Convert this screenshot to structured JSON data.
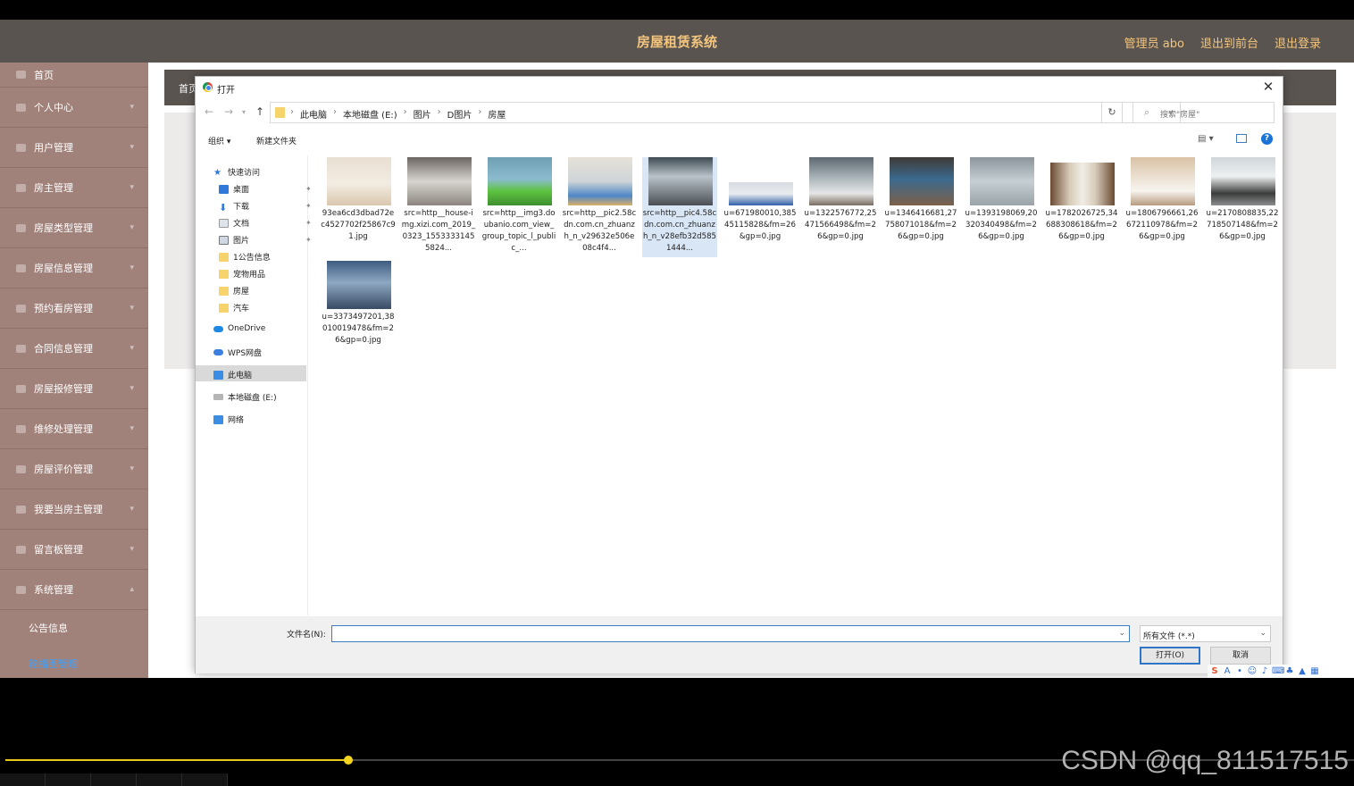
{
  "app": {
    "title": "房屋租赁系统",
    "header_links": [
      "管理员 abo",
      "退出到前台",
      "退出登录"
    ],
    "breadcrumb": "首页",
    "sidebar": [
      "首页",
      "个人中心",
      "用户管理",
      "房主管理",
      "房屋类型管理",
      "房屋信息管理",
      "预约看房管理",
      "合同信息管理",
      "房屋报修管理",
      "维修处理管理",
      "房屋评价管理",
      "我要当房主管理",
      "留言板管理",
      "系统管理"
    ],
    "sidebar_sub": [
      "公告信息",
      "轮播图管理"
    ],
    "sidebar_sub_active": "轮播图管理"
  },
  "dialog": {
    "title": "打开",
    "path": [
      "此电脑",
      "本地磁盘 (E:)",
      "图片",
      "D图片",
      "房屋"
    ],
    "search_placeholder": "搜索\"房屋\"",
    "toolbar": {
      "organize": "组织 ▾",
      "new_folder": "新建文件夹"
    },
    "nav": {
      "quick_access": "快速访问",
      "pinned": [
        "桌面",
        "下载",
        "文档",
        "图片"
      ],
      "folders": [
        "1公告信息",
        "宠物用品",
        "房屋",
        "汽车"
      ],
      "onedrive": "OneDrive",
      "wps": "WPS网盘",
      "this_pc": "此电脑",
      "local_disk": "本地磁盘 (E:)",
      "network": "网络"
    },
    "files": [
      "93ea6cd3dbad72ec4527702f25867c91.jpg",
      "src=http__house-img.xizi.com_2019_0323_15533331455824...",
      "src=http__img3.doubanio.com_view_group_topic_l_public_...",
      "src=http__pic2.58cdn.com.cn_zhuanzh_n_v29632e506e08c4f4...",
      "src=http__pic4.58cdn.com.cn_zhuanzh_n_v28efb32d5851444...",
      "u=671980010,38545115828&fm=26&gp=0.jpg",
      "u=1322576772,25471566498&fm=26&gp=0.jpg",
      "u=1346416681,27758071018&fm=26&gp=0.jpg",
      "u=1393198069,20320340498&fm=26&gp=0.jpg",
      "u=1782026725,34688308618&fm=26&gp=0.jpg",
      "u=1806796661,26672110978&fm=26&gp=0.jpg",
      "u=2170808835,22718507148&fm=26&gp=0.jpg",
      "u=3373497201,38010019478&fm=26&gp=0.jpg"
    ],
    "selected_file": "src=http__pic4.58cdn.com.cn_zhuanzh_n_v28efb32d5851444...",
    "filename_label": "文件名(N):",
    "filename_value": "",
    "filetype": "所有文件 (*.*)",
    "open_button": "打开(O)",
    "cancel_button": "取消"
  },
  "video": {
    "progress": 0.254,
    "watermark": "CSDN @qq_811517515"
  }
}
